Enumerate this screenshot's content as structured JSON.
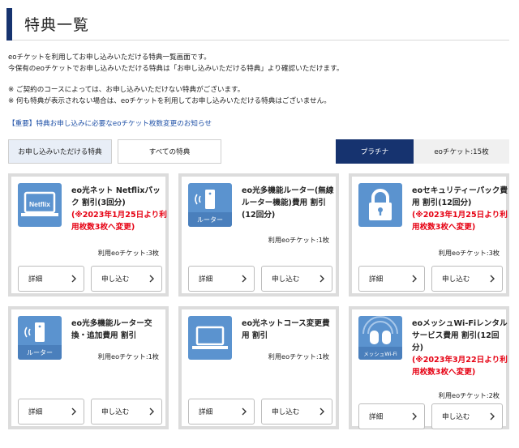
{
  "page": {
    "title": "特典一覧",
    "intro_line1": "eoチケットを利用してお申し込みいただける特典一覧画面です。",
    "intro_line2": "今保有のeoチケットでお申し込みいただける特典は「お申し込みいただける特典」より確認いただけます。",
    "note1": "※ ご契約のコースによっては、お申し込みいただけない特典がございます。",
    "note2": "※ 何も特典が表示されない場合は、eoチケットを利用してお申し込みいただける特典はございません。",
    "notice_link": "【重要】特典お申し込みに必要なeoチケット枚数変更のお知らせ"
  },
  "tabs": {
    "available": "お申し込みいただける特典",
    "all": "すべての特典"
  },
  "status": {
    "rank": "プラチナ",
    "tickets": "eoチケット:15枚"
  },
  "buttons": {
    "detail": "詳細",
    "apply": "申し込む"
  },
  "cards": [
    {
      "icon": "laptop-netflix-icon",
      "icon_text": "Netflix",
      "name": "eo光ネット Netflixパック 割引(3回分)",
      "red": "(※2023年1月25日より利用枚数3枚へ変更)",
      "usage": "利用eoチケット:3枚"
    },
    {
      "icon": "router-icon",
      "icon_text": "ルーター",
      "name": "eo光多機能ルーター(無線ルーター機能)費用 割引(12回分)",
      "red": "",
      "usage": "利用eoチケット:1枚"
    },
    {
      "icon": "padlock-icon",
      "icon_text": "",
      "name": "eoセキュリティーパック費用 割引(12回分)",
      "red": "(※2023年1月25日より利用枚数3枚へ変更)",
      "usage": "利用eoチケット:3枚"
    },
    {
      "icon": "router-icon",
      "icon_text": "ルーター",
      "name": "eo光多機能ルーター交換・追加費用 割引",
      "red": "",
      "usage": "利用eoチケット:1枚"
    },
    {
      "icon": "laptop-icon",
      "icon_text": "",
      "name": "eo光ネットコース変更費用 割引",
      "red": "",
      "usage": "利用eoチケット:1枚"
    },
    {
      "icon": "mesh-wifi-icon",
      "icon_text": "メッシュWi-Fi",
      "name": "eoメッシュWi-Fiレンタルサービス費用 割引(12回分)",
      "red": "(※2023年3月22日より利用枚数3枚へ変更)",
      "usage": "利用eoチケット:2枚"
    }
  ],
  "colors": {
    "brand_navy": "#16336f",
    "icon_blue": "#5b93cf",
    "alert_red": "#e60012",
    "link_blue": "#1d4fa6"
  }
}
